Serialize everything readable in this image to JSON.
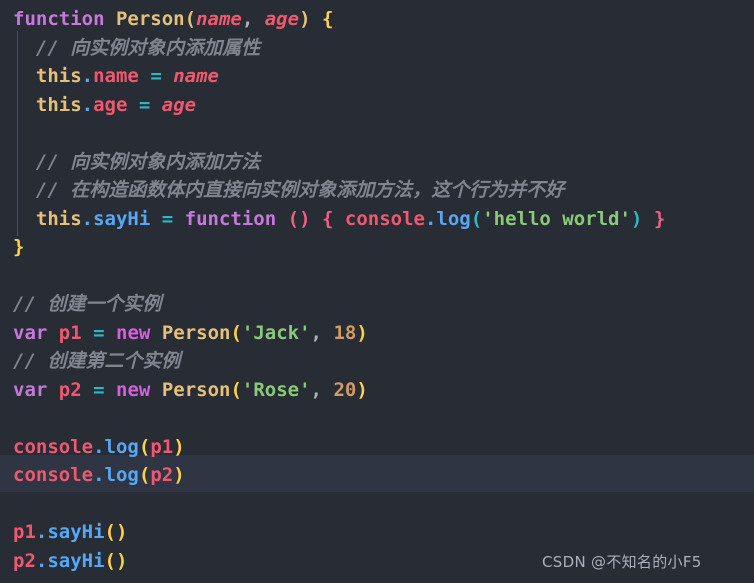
{
  "editor": {
    "language": "javascript",
    "background_color": "#282c34",
    "highlight_band_color": "#2f3542",
    "indent_guide_color": "#4a5160"
  },
  "watermark": {
    "text": "CSDN @不知名的小F5"
  },
  "code": {
    "full_text": "function Person(name, age) {\n  // 向实例对象内添加属性\n  this.name = name\n  this.age = age\n\n  // 向实例对象内添加方法\n  // 在构造函数体内直接向实例对象添加方法，这个行为并不好\n  this.sayHi = function () { console.log('hello world') }\n}\n\n// 创建一个实例\nvar p1 = new Person('Jack', 18)\n// 创建第二个实例\nvar p2 = new Person('Rose', 20)\n\nconsole.log(p1)\nconsole.log(p2)\n\np1.sayHi()\np2.sayHi()",
    "lines": [
      {
        "number": 1,
        "tokens": [
          {
            "text": "function",
            "type": "keyword"
          },
          {
            "text": " ",
            "type": "plain"
          },
          {
            "text": "Person",
            "type": "function-name"
          },
          {
            "text": "(",
            "type": "paren-yellow"
          },
          {
            "text": "name",
            "type": "parameter"
          },
          {
            "text": ",",
            "type": "punctuation"
          },
          {
            "text": " ",
            "type": "plain"
          },
          {
            "text": "age",
            "type": "parameter"
          },
          {
            "text": ")",
            "type": "paren-yellow"
          },
          {
            "text": " ",
            "type": "plain"
          },
          {
            "text": "{",
            "type": "brace-yellow"
          }
        ]
      },
      {
        "number": 2,
        "tokens": [
          {
            "text": "  ",
            "type": "plain"
          },
          {
            "text": "// 向实例对象内添加属性",
            "type": "comment"
          }
        ]
      },
      {
        "number": 3,
        "tokens": [
          {
            "text": "  ",
            "type": "plain"
          },
          {
            "text": "this",
            "type": "this-keyword"
          },
          {
            "text": ".",
            "type": "dot"
          },
          {
            "text": "name",
            "type": "property"
          },
          {
            "text": " ",
            "type": "plain"
          },
          {
            "text": "=",
            "type": "operator"
          },
          {
            "text": " ",
            "type": "plain"
          },
          {
            "text": "name",
            "type": "parameter"
          }
        ]
      },
      {
        "number": 4,
        "tokens": [
          {
            "text": "  ",
            "type": "plain"
          },
          {
            "text": "this",
            "type": "this-keyword"
          },
          {
            "text": ".",
            "type": "dot"
          },
          {
            "text": "age",
            "type": "property"
          },
          {
            "text": " ",
            "type": "plain"
          },
          {
            "text": "=",
            "type": "operator"
          },
          {
            "text": " ",
            "type": "plain"
          },
          {
            "text": "age",
            "type": "parameter"
          }
        ]
      },
      {
        "number": 5,
        "tokens": []
      },
      {
        "number": 6,
        "tokens": [
          {
            "text": "  ",
            "type": "plain"
          },
          {
            "text": "// 向实例对象内添加方法",
            "type": "comment"
          }
        ]
      },
      {
        "number": 7,
        "tokens": [
          {
            "text": "  ",
            "type": "plain"
          },
          {
            "text": "// 在构造函数体内直接向实例对象添加方法，这个行为并不好",
            "type": "comment"
          }
        ]
      },
      {
        "number": 8,
        "tokens": [
          {
            "text": "  ",
            "type": "plain"
          },
          {
            "text": "this",
            "type": "this-keyword"
          },
          {
            "text": ".",
            "type": "dot"
          },
          {
            "text": "sayHi",
            "type": "method"
          },
          {
            "text": " ",
            "type": "plain"
          },
          {
            "text": "=",
            "type": "operator"
          },
          {
            "text": " ",
            "type": "plain"
          },
          {
            "text": "function",
            "type": "keyword"
          },
          {
            "text": " ",
            "type": "plain"
          },
          {
            "text": "()",
            "type": "paren-pink"
          },
          {
            "text": " ",
            "type": "plain"
          },
          {
            "text": "{",
            "type": "brace-pink"
          },
          {
            "text": " ",
            "type": "plain"
          },
          {
            "text": "console",
            "type": "object"
          },
          {
            "text": ".",
            "type": "dot"
          },
          {
            "text": "log",
            "type": "method"
          },
          {
            "text": "(",
            "type": "paren-cyan"
          },
          {
            "text": "'hello world'",
            "type": "string"
          },
          {
            "text": ")",
            "type": "paren-cyan"
          },
          {
            "text": " ",
            "type": "plain"
          },
          {
            "text": "}",
            "type": "brace-pink"
          }
        ]
      },
      {
        "number": 9,
        "tokens": [
          {
            "text": "}",
            "type": "brace-yellow"
          }
        ]
      },
      {
        "number": 10,
        "tokens": []
      },
      {
        "number": 11,
        "tokens": [
          {
            "text": "// 创建一个实例",
            "type": "comment"
          }
        ]
      },
      {
        "number": 12,
        "tokens": [
          {
            "text": "var",
            "type": "keyword"
          },
          {
            "text": " ",
            "type": "plain"
          },
          {
            "text": "p1",
            "type": "variable"
          },
          {
            "text": " ",
            "type": "plain"
          },
          {
            "text": "=",
            "type": "operator"
          },
          {
            "text": " ",
            "type": "plain"
          },
          {
            "text": "new",
            "type": "keyword-new"
          },
          {
            "text": " ",
            "type": "plain"
          },
          {
            "text": "Person",
            "type": "function-name"
          },
          {
            "text": "(",
            "type": "paren-gold"
          },
          {
            "text": "'Jack'",
            "type": "string"
          },
          {
            "text": ",",
            "type": "punctuation"
          },
          {
            "text": " ",
            "type": "plain"
          },
          {
            "text": "18",
            "type": "number"
          },
          {
            "text": ")",
            "type": "paren-gold"
          }
        ]
      },
      {
        "number": 13,
        "tokens": [
          {
            "text": "// 创建第二个实例",
            "type": "comment"
          }
        ]
      },
      {
        "number": 14,
        "tokens": [
          {
            "text": "var",
            "type": "keyword"
          },
          {
            "text": " ",
            "type": "plain"
          },
          {
            "text": "p2",
            "type": "variable"
          },
          {
            "text": " ",
            "type": "plain"
          },
          {
            "text": "=",
            "type": "operator"
          },
          {
            "text": " ",
            "type": "plain"
          },
          {
            "text": "new",
            "type": "keyword-new"
          },
          {
            "text": " ",
            "type": "plain"
          },
          {
            "text": "Person",
            "type": "function-name"
          },
          {
            "text": "(",
            "type": "paren-gold"
          },
          {
            "text": "'Rose'",
            "type": "string"
          },
          {
            "text": ",",
            "type": "punctuation"
          },
          {
            "text": " ",
            "type": "plain"
          },
          {
            "text": "20",
            "type": "number"
          },
          {
            "text": ")",
            "type": "paren-gold"
          }
        ]
      },
      {
        "number": 15,
        "tokens": []
      },
      {
        "number": 16,
        "tokens": [
          {
            "text": "console",
            "type": "object"
          },
          {
            "text": ".",
            "type": "dot"
          },
          {
            "text": "log",
            "type": "method"
          },
          {
            "text": "(",
            "type": "paren-gold"
          },
          {
            "text": "p1",
            "type": "variable"
          },
          {
            "text": ")",
            "type": "paren-gold"
          }
        ]
      },
      {
        "number": 17,
        "tokens": [
          {
            "text": "console",
            "type": "object"
          },
          {
            "text": ".",
            "type": "dot"
          },
          {
            "text": "log",
            "type": "method"
          },
          {
            "text": "(",
            "type": "paren-gold"
          },
          {
            "text": "p2",
            "type": "variable"
          },
          {
            "text": ")",
            "type": "paren-gold"
          }
        ]
      },
      {
        "number": 18,
        "tokens": []
      },
      {
        "number": 19,
        "tokens": [
          {
            "text": "p1",
            "type": "variable"
          },
          {
            "text": ".",
            "type": "dot"
          },
          {
            "text": "sayHi",
            "type": "method"
          },
          {
            "text": "()",
            "type": "paren-gold"
          }
        ]
      },
      {
        "number": 20,
        "tokens": [
          {
            "text": "p2",
            "type": "variable"
          },
          {
            "text": ".",
            "type": "dot"
          },
          {
            "text": "sayHi",
            "type": "method"
          },
          {
            "text": "()",
            "type": "paren-gold"
          }
        ]
      }
    ]
  }
}
